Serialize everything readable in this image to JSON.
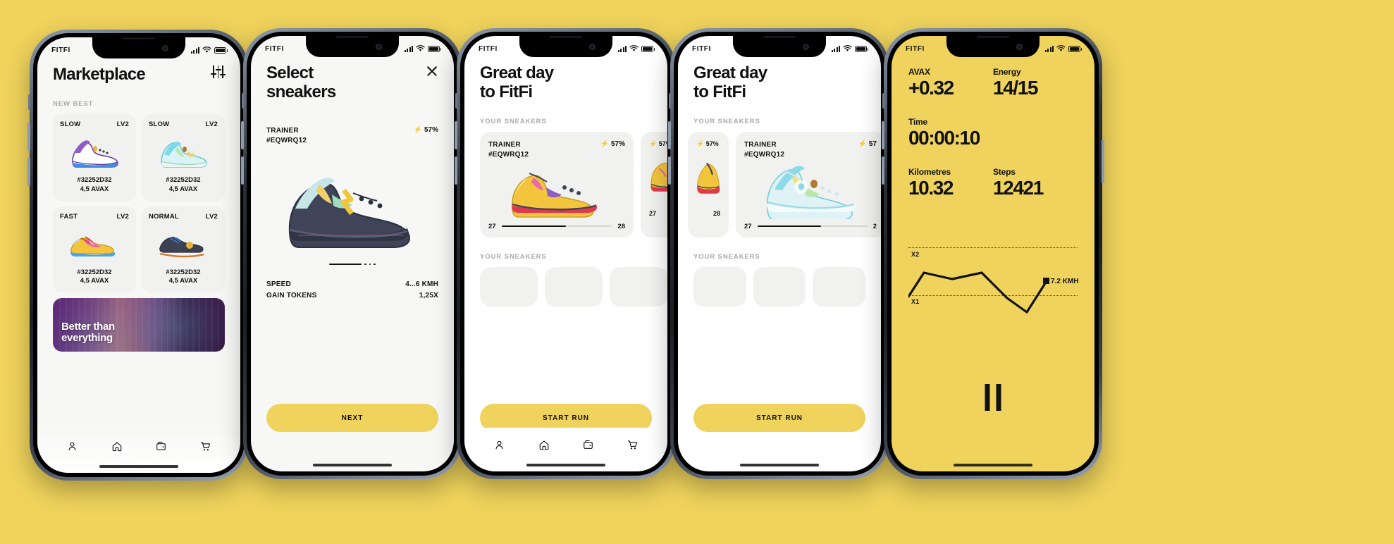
{
  "background_color": "#efd35c",
  "accent_color": "#efd35c",
  "brand": "FITFI",
  "phones": [
    {
      "id": "marketplace",
      "screen_bg": "#f7f7f5",
      "title": "Marketplace",
      "filter_icon": "sliders-icon",
      "section_label": "NEW BEST",
      "cards": [
        {
          "speed": "SLOW",
          "level": "LV2",
          "id": "#32252D32",
          "price": "4,5 AVAX",
          "shoe": "purple-high-top"
        },
        {
          "speed": "SLOW",
          "level": "LV2",
          "id": "#32252D32",
          "price": "4,5 AVAX",
          "shoe": "cyan-high-top"
        },
        {
          "speed": "FAST",
          "level": "LV2",
          "id": "#32252D32",
          "price": "4,5 AVAX",
          "shoe": "yellow-pink-low"
        },
        {
          "speed": "NORMAL",
          "level": "LV2",
          "id": "#32252D32",
          "price": "4,5 AVAX",
          "shoe": "navy-low"
        }
      ],
      "banner": {
        "line1": "Better than",
        "line2": "everything"
      },
      "tabs": [
        {
          "name": "profile",
          "icon": "person-icon",
          "active": false
        },
        {
          "name": "home",
          "icon": "home-icon",
          "active": true
        },
        {
          "name": "wallet",
          "icon": "wallet-icon",
          "active": false
        },
        {
          "name": "cart",
          "icon": "cart-icon",
          "active": false
        }
      ]
    },
    {
      "id": "select-sneakers",
      "screen_bg": "#f7f7f5",
      "title_line1": "Select",
      "title_line2": "sneakers",
      "close_icon": "close-icon",
      "trainer_label": "TRAINER",
      "trainer_id": "#EQWRQ12",
      "charge": "⚡ 57%",
      "stats": [
        {
          "label": "SPEED",
          "value": "4...6 KMH"
        },
        {
          "label": "GAIN TOKENS",
          "value": "1,25X"
        }
      ],
      "cta_label": "NEXT"
    },
    {
      "id": "great-day-1",
      "screen_bg": "#ffffff",
      "title_line1": "Great day",
      "title_line2": "to FitFi",
      "section_label": "YOUR SNEAKERS",
      "section_label_2": "YOUR SNEAKERS",
      "card": {
        "trainer_label": "TRAINER",
        "trainer_id": "#EQWRQ12",
        "charge": "⚡ 57%",
        "slider_min": "27",
        "slider_max": "28",
        "shoe": "yellow-red-low"
      },
      "peek_charge": "⚡ 57%",
      "cta_label": "START RUN",
      "tabs": [
        {
          "name": "profile",
          "icon": "person-icon",
          "active": false
        },
        {
          "name": "home",
          "icon": "home-icon",
          "active": true
        },
        {
          "name": "wallet",
          "icon": "wallet-icon",
          "active": false
        },
        {
          "name": "cart",
          "icon": "cart-icon",
          "active": false
        }
      ]
    },
    {
      "id": "great-day-2",
      "screen_bg": "#ffffff",
      "title_line1": "Great day",
      "title_line2": "to FitFi",
      "section_label": "YOUR SNEAKERS",
      "section_label_2": "YOUR SNEAKERS",
      "left_peek_charge": "⚡ 57%",
      "left_peek_max": "28",
      "card": {
        "trainer_label": "TRAINER",
        "trainer_id": "#EQWRQ12",
        "charge": "⚡ 57",
        "slider_min": "27",
        "slider_max": "2",
        "shoe": "cyan-high-top"
      },
      "cta_label": "START RUN"
    },
    {
      "id": "run-active",
      "screen_bg": "#efd35c",
      "metrics": [
        {
          "label": "AVAX",
          "value": "+0.32"
        },
        {
          "label": "Energy",
          "value": "14/15"
        },
        {
          "label": "Time",
          "value": "00:00:10"
        },
        {
          "label": "Kilometres",
          "value": "10.32"
        },
        {
          "label": "Steps",
          "value": "12421"
        }
      ],
      "pause_icon": "pause-icon"
    }
  ],
  "chart_data": {
    "type": "line",
    "title": "",
    "xlabel": "",
    "ylabel": "",
    "gridlines": [
      {
        "label": "X2",
        "y": 2
      },
      {
        "label": "X1",
        "y": 1
      }
    ],
    "ylim": [
      0,
      2.4
    ],
    "grid": true,
    "legend": "none",
    "annotation": "7.2 KMH",
    "series": [
      {
        "name": "speed",
        "x": [
          0,
          1,
          2,
          3,
          4,
          5,
          6
        ],
        "values": [
          1.05,
          1.55,
          1.42,
          1.55,
          0.9,
          0.52,
          1.3
        ]
      }
    ]
  }
}
